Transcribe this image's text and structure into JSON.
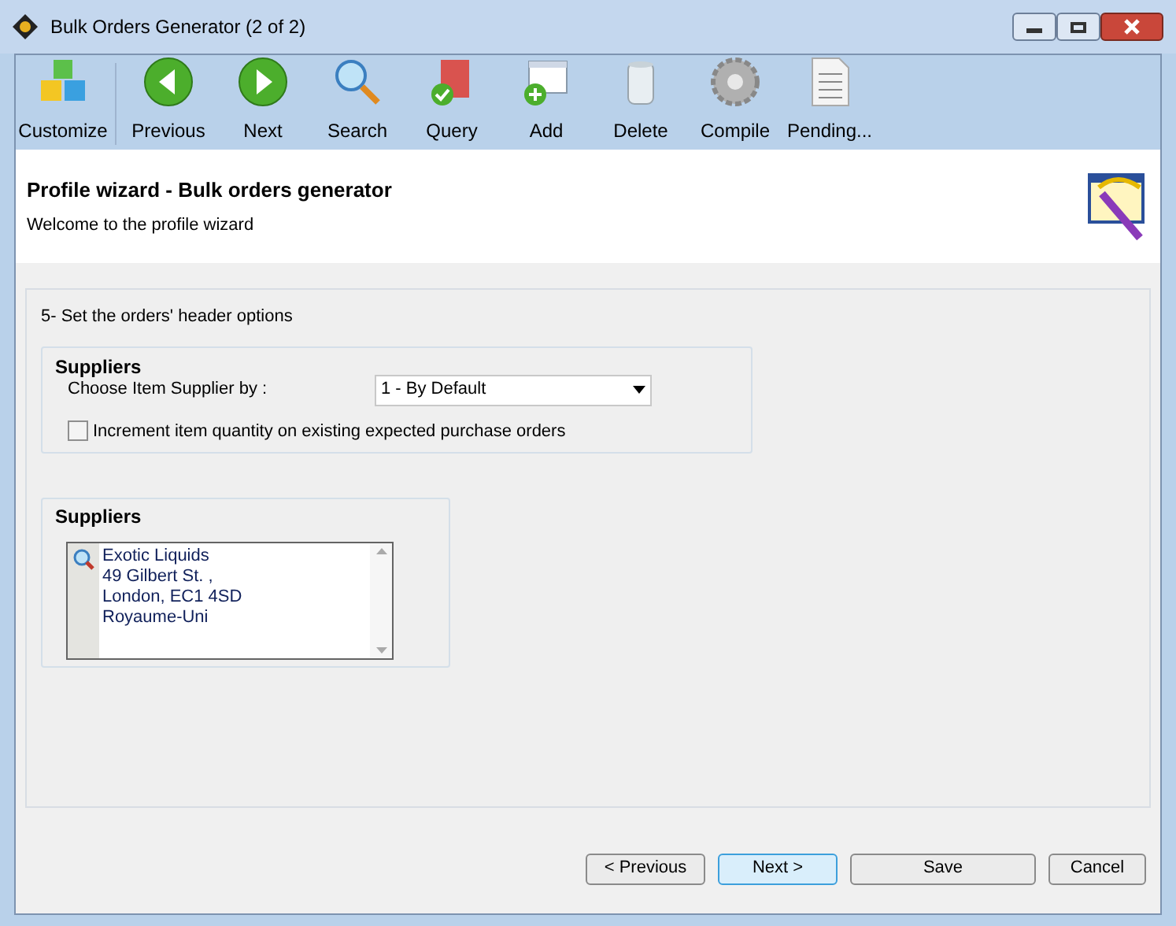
{
  "window": {
    "title": "Bulk Orders Generator (2 of 2)"
  },
  "toolbar": [
    {
      "label": "Customize",
      "kind": "cubes"
    },
    {
      "label": "Previous",
      "kind": "back"
    },
    {
      "label": "Next",
      "kind": "forward"
    },
    {
      "label": "Search",
      "kind": "search"
    },
    {
      "label": "Query",
      "kind": "query"
    },
    {
      "label": "Add",
      "kind": "add"
    },
    {
      "label": "Delete",
      "kind": "delete"
    },
    {
      "label": "Compile",
      "kind": "compile"
    },
    {
      "label": "Pending...",
      "kind": "pending"
    }
  ],
  "header": {
    "title": "Profile wizard - Bulk orders generator",
    "subtitle": "Welcome to the profile wizard"
  },
  "step": "5- Set the orders' header options",
  "supplier_options": {
    "title": "Suppliers",
    "choose_label": "Choose Item Supplier by :",
    "choose_value": "1 - By Default",
    "increment": {
      "label": "Increment item quantity on existing expected purchase orders",
      "checked": false
    }
  },
  "suppliers": {
    "title": "Suppliers",
    "lines": [
      "Exotic Liquids",
      "49 Gilbert St. ,",
      "London, EC1 4SD",
      "Royaume-Uni"
    ]
  },
  "buttons": [
    {
      "label": "< Previous",
      "default": false
    },
    {
      "label": "Next >",
      "default": true
    },
    {
      "label": "Save",
      "default": false
    },
    {
      "label": "Cancel",
      "default": false
    }
  ]
}
